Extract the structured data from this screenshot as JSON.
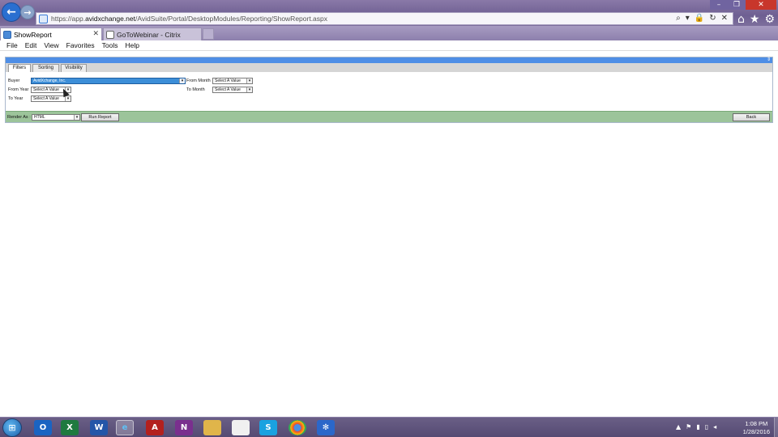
{
  "browser": {
    "url_prefix": "https://app.",
    "url_host": "avidxchange.net",
    "url_path": "/AvidSuite/Portal/DesktopModules/Reporting/ShowReport.aspx",
    "tabs": [
      {
        "label": "ShowReport",
        "active": true
      },
      {
        "label": "GoToWebinar - Citrix",
        "active": false
      }
    ]
  },
  "menu": [
    "File",
    "Edit",
    "View",
    "Favorites",
    "Tools",
    "Help"
  ],
  "report": {
    "subtabs": [
      "Filters",
      "Sorting",
      "Visibility"
    ],
    "filters": {
      "buyer_label": "Buyer",
      "buyer_value": "AvidXchange, Inc.",
      "from_year_label": "From Year",
      "from_year_value": "Select A Value",
      "to_year_label": "To Year",
      "to_year_value": "Select A Value",
      "from_month_label": "From Month",
      "from_month_value": "Select A Value",
      "to_month_label": "To Month",
      "to_month_value": "Select A Value"
    },
    "render_label": "Render As :",
    "render_value": "HTML",
    "run_label": "Run Report",
    "back_label": "Back"
  },
  "taskbar": {
    "apps": [
      "outlook-icon",
      "excel-icon",
      "word-icon",
      "internet-explorer-icon",
      "acrobat-icon",
      "onenote-icon",
      "file-explorer-icon",
      "notepad-icon",
      "skype-icon",
      "chrome-icon",
      "app-icon"
    ],
    "time": "1:08 PM",
    "date": "1/28/2016"
  },
  "colors": {
    "accent_blue": "#4e8ee6",
    "render_bar_green": "#9cc49a",
    "buyer_selected": "#3c8ed8"
  }
}
